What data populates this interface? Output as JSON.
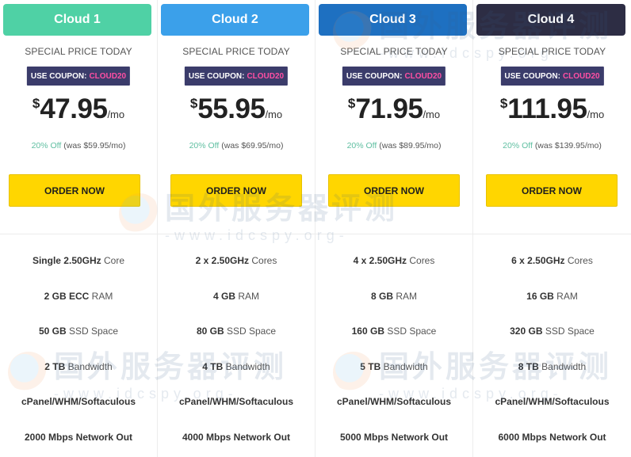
{
  "special_label": "SPECIAL PRICE TODAY",
  "coupon_label": "USE COUPON:",
  "coupon_code": "CLOUD20",
  "order_label": "ORDER NOW",
  "watermark": {
    "cn": "国外服务器评测",
    "en": "-www.idcspy.org-"
  },
  "colors": {
    "cloud1": "#4fd1a5",
    "cloud2": "#3ba0ea",
    "cloud3": "#1e70c1",
    "cloud4": "#2d2d44",
    "coupon_bg": "#3b3c6b",
    "coupon_code": "#ff4fa3",
    "order_bg": "#ffd600",
    "discount": "#5fbfa1"
  },
  "plans": [
    {
      "name": "Cloud 1",
      "currency": "$",
      "amount": "47.95",
      "period": "/mo",
      "off": "20% Off",
      "was": "(was $59.95/mo)",
      "features": [
        {
          "strong": "Single 2.50GHz",
          "rest": " Core"
        },
        {
          "strong": "2 GB ECC",
          "rest": " RAM"
        },
        {
          "strong": "50 GB",
          "rest": " SSD Space"
        },
        {
          "strong": "2 TB",
          "rest": " Bandwidth"
        },
        {
          "strong": "cPanel/WHM/Softaculous",
          "rest": ""
        },
        {
          "strong": "2000 Mbps Network Out",
          "rest": ""
        }
      ]
    },
    {
      "name": "Cloud 2",
      "currency": "$",
      "amount": "55.95",
      "period": "/mo",
      "off": "20% Off",
      "was": "(was $69.95/mo)",
      "features": [
        {
          "strong": "2 x 2.50GHz",
          "rest": " Cores"
        },
        {
          "strong": "4 GB",
          "rest": " RAM"
        },
        {
          "strong": "80 GB",
          "rest": " SSD Space"
        },
        {
          "strong": "4 TB",
          "rest": " Bandwidth"
        },
        {
          "strong": "cPanel/WHM/Softaculous",
          "rest": ""
        },
        {
          "strong": "4000 Mbps Network Out",
          "rest": ""
        }
      ]
    },
    {
      "name": "Cloud 3",
      "currency": "$",
      "amount": "71.95",
      "period": "/mo",
      "off": "20% Off",
      "was": "(was $89.95/mo)",
      "features": [
        {
          "strong": "4 x 2.50GHz",
          "rest": " Cores"
        },
        {
          "strong": "8 GB",
          "rest": " RAM"
        },
        {
          "strong": "160 GB",
          "rest": " SSD Space"
        },
        {
          "strong": "5 TB",
          "rest": " Bandwidth"
        },
        {
          "strong": "cPanel/WHM/Softaculous",
          "rest": ""
        },
        {
          "strong": "5000 Mbps Network Out",
          "rest": ""
        }
      ]
    },
    {
      "name": "Cloud 4",
      "currency": "$",
      "amount": "111.95",
      "period": "/mo",
      "off": "20% Off",
      "was": "(was $139.95/mo)",
      "features": [
        {
          "strong": "6 x 2.50GHz",
          "rest": " Cores"
        },
        {
          "strong": "16 GB",
          "rest": " RAM"
        },
        {
          "strong": "320 GB",
          "rest": " SSD Space"
        },
        {
          "strong": "8 TB",
          "rest": " Bandwidth"
        },
        {
          "strong": "cPanel/WHM/Softaculous",
          "rest": ""
        },
        {
          "strong": "6000 Mbps Network Out",
          "rest": ""
        }
      ]
    }
  ]
}
